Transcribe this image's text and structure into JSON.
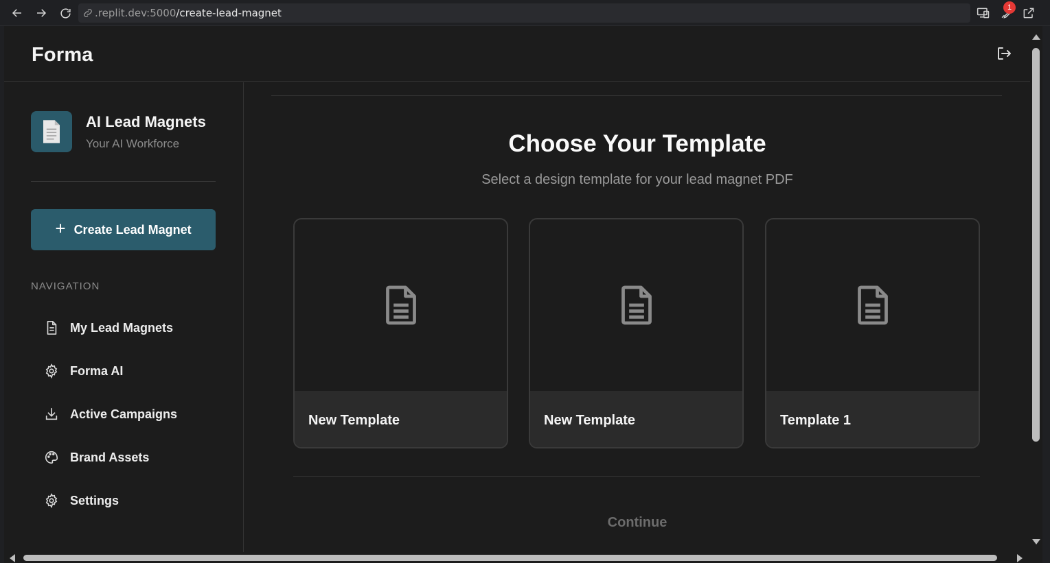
{
  "browser": {
    "url_domain": ".replit.dev:5000",
    "url_path": "/create-lead-magnet",
    "notification_count": "1"
  },
  "header": {
    "brand": "Forma"
  },
  "sidebar": {
    "product_title": "AI Lead Magnets",
    "product_subtitle": "Your AI Workforce",
    "create_button": "Create Lead Magnet",
    "nav_heading": "NAVIGATION",
    "items": [
      {
        "label": "My Lead Magnets",
        "icon": "document-icon"
      },
      {
        "label": "Forma AI",
        "icon": "gear-icon"
      },
      {
        "label": "Active Campaigns",
        "icon": "download-icon"
      },
      {
        "label": "Brand Assets",
        "icon": "palette-icon"
      },
      {
        "label": "Settings",
        "icon": "gear-icon"
      }
    ]
  },
  "main": {
    "title": "Choose Your Template",
    "subtitle": "Select a design template for your lead magnet PDF",
    "templates": [
      {
        "name": "New Template"
      },
      {
        "name": "New Template"
      },
      {
        "name": "Template 1"
      }
    ],
    "continue_label": "Continue"
  },
  "colors": {
    "background": "#1c1c1c",
    "accent": "#2b5c6c",
    "card_footer": "#2b2b2b"
  }
}
